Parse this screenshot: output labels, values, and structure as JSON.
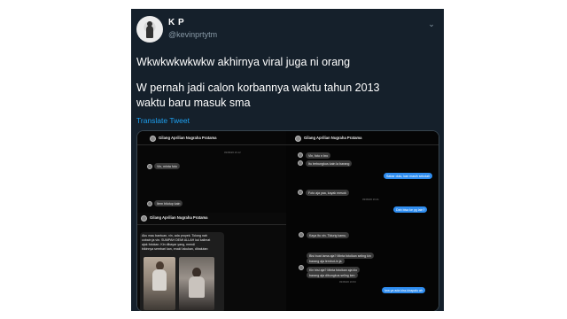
{
  "tweet": {
    "display_name": "K P",
    "handle": "@kevinprtytm",
    "text_line1": "Wkwkwkwkwkw akhirnya viral juga ni orang",
    "text_line2": "W pernah jadi calon korbannya waktu tahun 2013",
    "text_line3": "waktu baru masuk sma",
    "translate_label": "Translate Tweet",
    "menu_icon": "chevron-down-icon"
  },
  "media": {
    "chat1": {
      "contact": "Gilang Aprilian Nugraha Pratama",
      "timestamp": "03/09/26 16.12",
      "messages": [
        {
          "side": "left",
          "text": "Vin, minta foto"
        },
        {
          "side": "left",
          "text": "Item bitutup kain"
        }
      ]
    },
    "chat2": {
      "contact": "Gilang Aprilian Nugraha Pratama",
      "messages": [
        {
          "side": "left",
          "text": "Vin, foto n bro"
        },
        {
          "side": "left",
          "text": "Itu terbungkus kain la barang"
        },
        {
          "side": "right",
          "text": "Sabar dulu, kan masih sekolah"
        },
        {
          "side": "left",
          "text": "Foto aja yaa, kayak mesok"
        },
        {
          "side": "right",
          "text": "Dah bisa ke yg lain?"
        }
      ],
      "time1": "03/09/26 16.00",
      "time2": "03/09/26 16.41"
    },
    "chat3": {
      "contact": "Gilang Aprilian Nugraha Pratama",
      "caption_lines": [
        "Aku mau bantuan, vin, ada proyek. Tolong nah",
        "cobain ja vin. SUMPAH DEMI ALLAH kul kalimat",
        "ajak fotokan. Kin dibayar yang, mendi",
        "bikinnya sembari kan, enak! lakukan, dibalutan"
      ]
    },
    "chat4": {
      "messages": [
        {
          "side": "left",
          "text": "Kaya itu vin. Tidurig kamu."
        },
        {
          "side": "left",
          "text": "Bisi buat lama aja? Minta fotoikan seling kin"
        },
        {
          "side": "left",
          "text": "barang aja lembut-in ja"
        },
        {
          "side": "left",
          "text": "Kin bisi aja? Minta fotoikan aja klo"
        },
        {
          "side": "left",
          "text": "barang aja dibungkus seling ken"
        },
        {
          "side": "right",
          "text": "Iwa ya ada kira-kirapalu ah"
        }
      ],
      "time": "03/09/26 16.53"
    }
  }
}
